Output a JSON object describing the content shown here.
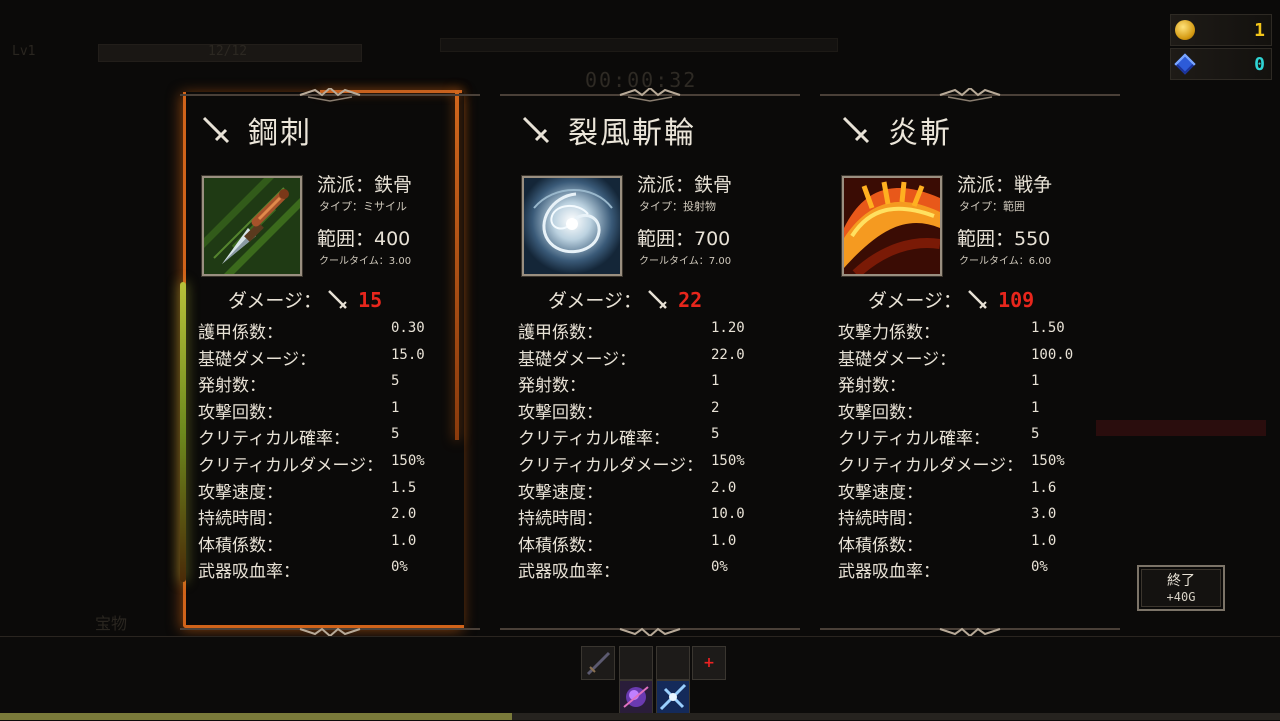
{
  "hud": {
    "level": "Lv1",
    "xp_text": "12/12",
    "timer": "00:00:32",
    "treasure_label": "宝物",
    "gold": "1",
    "gems": "0",
    "xp_progress": 0.4
  },
  "cards": [
    {
      "title": "鋼刺",
      "school": "流派：鉄骨",
      "type": "タイプ：ミサイル",
      "range": "範囲：400",
      "cooldown": "クールタイム：3.00",
      "damage_label": "ダメージ：",
      "damage": "15",
      "image": "dagger-icon",
      "stats": [
        {
          "label": "護甲係数：",
          "value": "0.30"
        },
        {
          "label": "基礎ダメージ：",
          "value": "15.0"
        },
        {
          "label": "発射数：",
          "value": "5"
        },
        {
          "label": "攻撃回数：",
          "value": "1"
        },
        {
          "label": "クリティカル確率：",
          "value": "5"
        },
        {
          "label": "クリティカルダメージ：",
          "value": "150%"
        },
        {
          "label": "攻撃速度：",
          "value": "1.5"
        },
        {
          "label": "持続時間：",
          "value": "2.0"
        },
        {
          "label": "体積係数：",
          "value": "1.0"
        },
        {
          "label": "武器吸血率：",
          "value": "0%"
        }
      ]
    },
    {
      "title": "裂風斬輪",
      "school": "流派：鉄骨",
      "type": "タイプ：投射物",
      "range": "範囲：700",
      "cooldown": "クールタイム：7.00",
      "damage_label": "ダメージ：",
      "damage": "22",
      "image": "whirlwind-icon",
      "stats": [
        {
          "label": "護甲係数：",
          "value": "1.20"
        },
        {
          "label": "基礎ダメージ：",
          "value": "22.0"
        },
        {
          "label": "発射数：",
          "value": "1"
        },
        {
          "label": "攻撃回数：",
          "value": "2"
        },
        {
          "label": "クリティカル確率：",
          "value": "5"
        },
        {
          "label": "クリティカルダメージ：",
          "value": "150%"
        },
        {
          "label": "攻撃速度：",
          "value": "2.0"
        },
        {
          "label": "持続時間：",
          "value": "10.0"
        },
        {
          "label": "体積係数：",
          "value": "1.0"
        },
        {
          "label": "武器吸血率：",
          "value": "0%"
        }
      ]
    },
    {
      "title": "炎斬",
      "school": "流派：戦争",
      "type": "タイプ：範囲",
      "range": "範囲：550",
      "cooldown": "クールタイム：6.00",
      "damage_label": "ダメージ：",
      "damage": "109",
      "image": "flame-slash-icon",
      "stats": [
        {
          "label": "攻撃力係数：",
          "value": "1.50"
        },
        {
          "label": "基礎ダメージ：",
          "value": "100.0"
        },
        {
          "label": "発射数：",
          "value": "1"
        },
        {
          "label": "攻撃回数：",
          "value": "1"
        },
        {
          "label": "クリティカル確率：",
          "value": "5"
        },
        {
          "label": "クリティカルダメージ：",
          "value": "150%"
        },
        {
          "label": "攻撃速度：",
          "value": "1.6"
        },
        {
          "label": "持続時間：",
          "value": "3.0"
        },
        {
          "label": "体積係数：",
          "value": "1.0"
        },
        {
          "label": "武器吸血率：",
          "value": "0%"
        }
      ]
    }
  ],
  "end_button": {
    "line1": "終了",
    "line2": "+40G"
  },
  "inventory": {
    "add_label": "+",
    "bottom_progress": 0.4
  },
  "colors": {
    "damage": "#e8261c",
    "selection_glow": "#d0631a",
    "gold_value": "#f2c51a",
    "gem_value": "#2fd4d4"
  }
}
